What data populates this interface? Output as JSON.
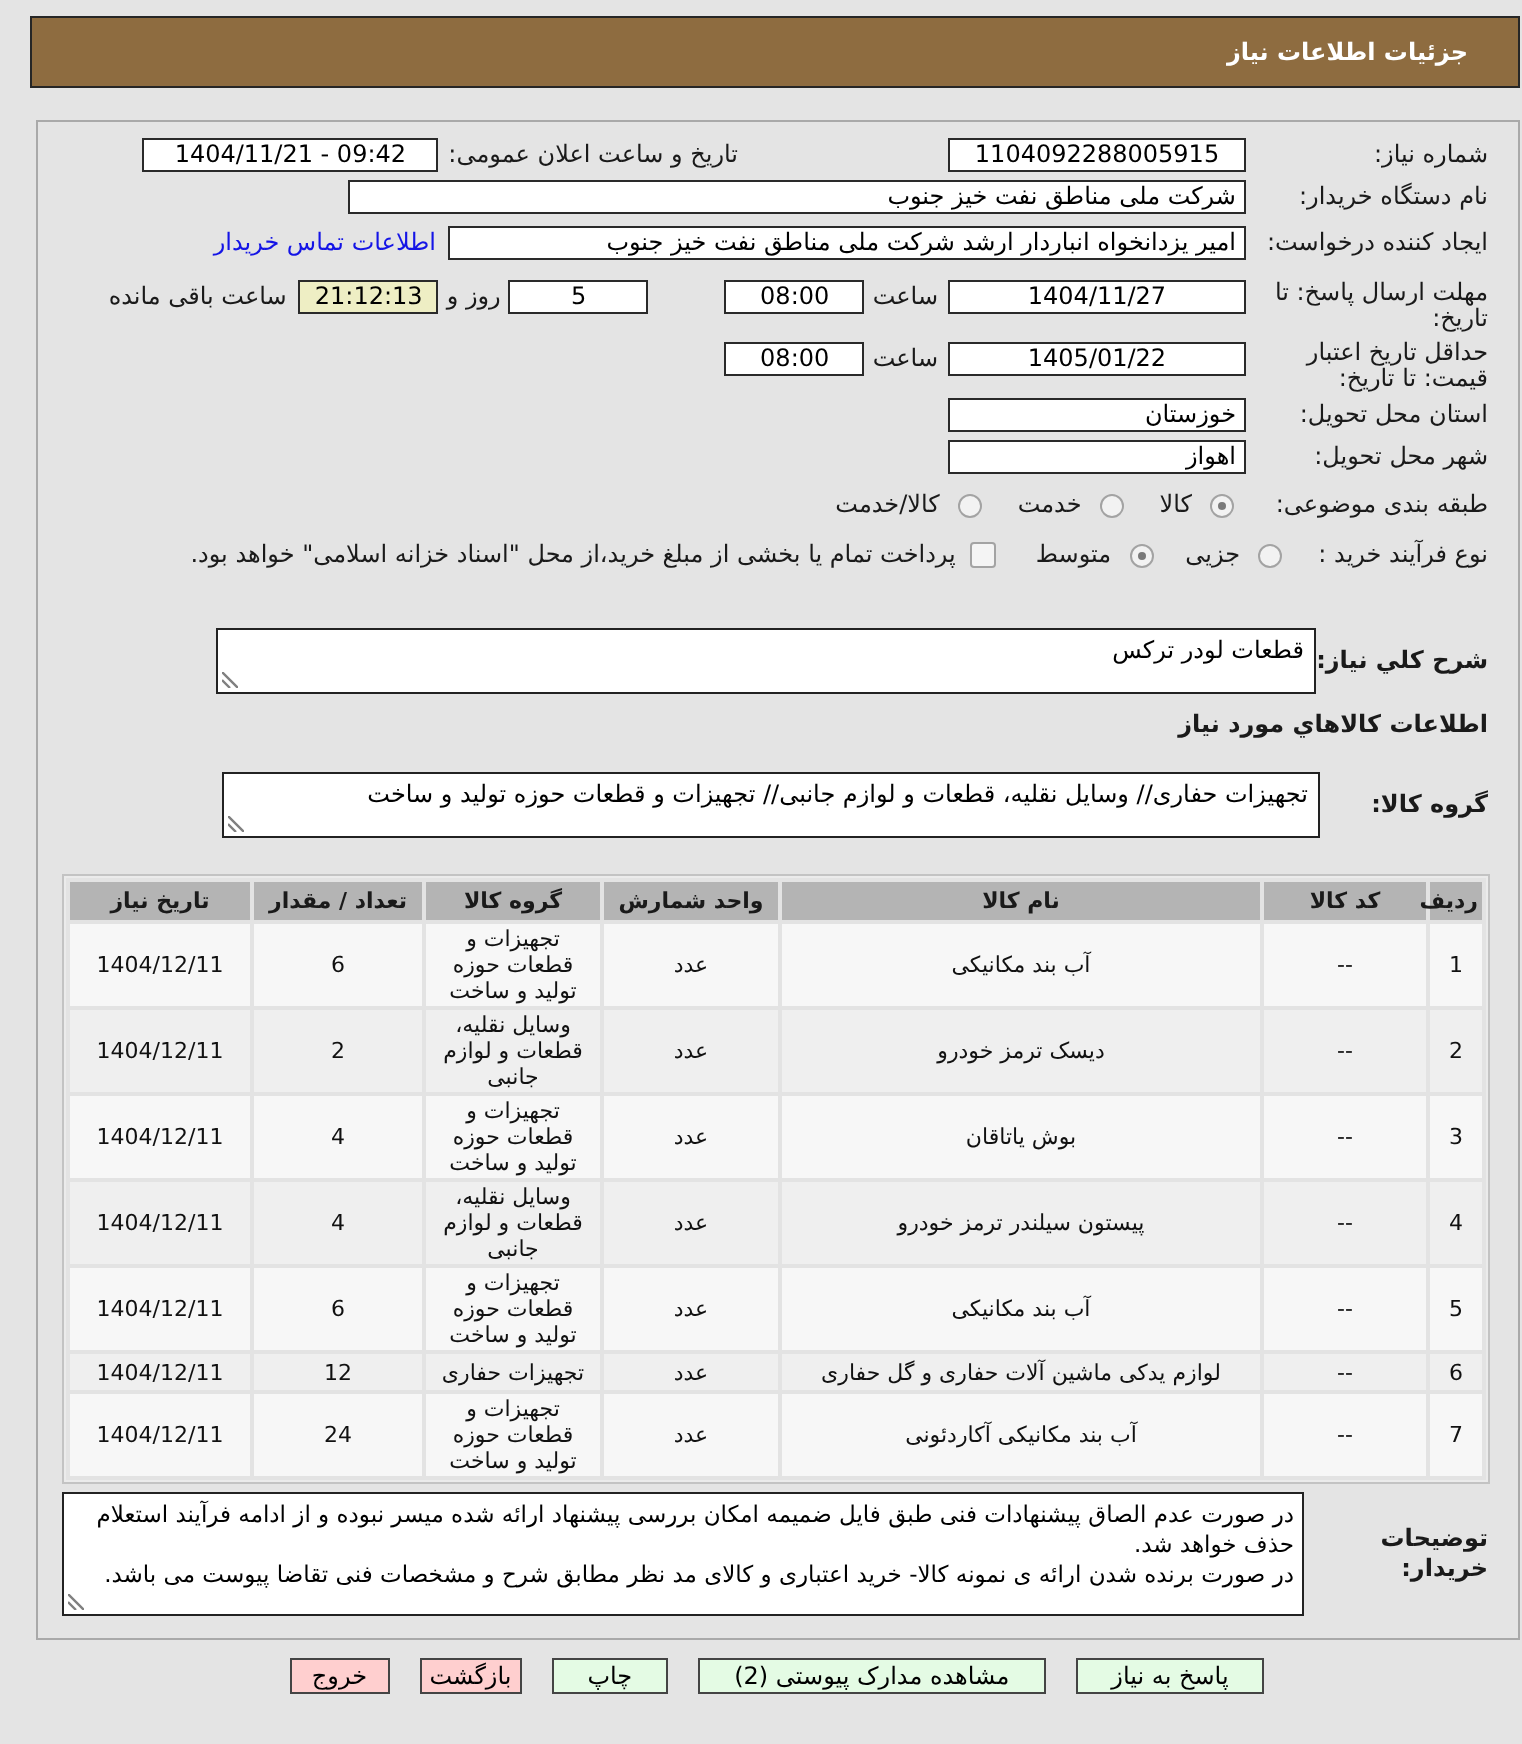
{
  "header": {
    "title": "جزئیات اطلاعات نیاز"
  },
  "form": {
    "need_number": {
      "label": "شماره نیاز:",
      "value": "1104092288005915"
    },
    "announcement": {
      "label": "تاریخ و ساعت اعلان عمومی:",
      "value": "1404/11/21 - 09:42"
    },
    "buyer_org": {
      "label": "نام دستگاه خریدار:",
      "value": "شرکت ملی مناطق نفت خیز جنوب"
    },
    "requester": {
      "label": "ایجاد کننده درخواست:",
      "value": "امیر یزدانخواه انباردار ارشد شرکت ملی مناطق نفت خیز جنوب",
      "contact_link": "اطلاعات تماس خریدار"
    },
    "reply_deadline": {
      "label": "مهلت ارسال پاسخ: تا تاریخ:",
      "date": "1404/11/27",
      "time_label": "ساعت",
      "time": "08:00",
      "days": "5",
      "days_label": "روز و",
      "remaining": "21:12:13",
      "remaining_label": "ساعت باقی مانده"
    },
    "price_validity": {
      "label": "حداقل تاریخ اعتبار قیمت: تا تاریخ:",
      "date": "1405/01/22",
      "time_label": "ساعت",
      "time": "08:00"
    },
    "province": {
      "label": "استان محل تحویل:",
      "value": "خوزستان"
    },
    "city": {
      "label": "شهر محل تحویل:",
      "value": "اهواز"
    },
    "category": {
      "label": "طبقه بندی موضوعی:",
      "options": [
        {
          "label": "کالا",
          "selected": true
        },
        {
          "label": "خدمت",
          "selected": false
        },
        {
          "label": "کالا/خدمت",
          "selected": false
        }
      ]
    },
    "purchase_process": {
      "label": "نوع فرآیند خرید :",
      "options": [
        {
          "label": "جزیی",
          "selected": false
        },
        {
          "label": "متوسط",
          "selected": true
        }
      ],
      "treasury_payment": {
        "label": "پرداخت تمام یا بخشی از مبلغ خرید،از محل \"اسناد خزانه اسلامی\" خواهد بود.",
        "checked": false
      }
    },
    "summary": {
      "label": "شرح کلي نياز:",
      "value": "قطعات لودر ترکس"
    },
    "goods_heading": "اطلاعات کالاهاي مورد نياز",
    "goods_group": {
      "label": "گروه کالا:",
      "value": "تجهیزات حفاری// وسایل نقلیه، قطعات و لوازم جانبی// تجهیزات و قطعات حوزه تولید و ساخت"
    },
    "goods_table": {
      "columns": [
        "ردیف",
        "کد کالا",
        "نام کالا",
        "واحد شمارش",
        "گروه کالا",
        "تعداد / مقدار",
        "تاریخ نیاز"
      ],
      "rows": [
        [
          "1",
          "--",
          "آب بند مکانیکی",
          "عدد",
          "تجهیزات و قطعات حوزه تولید و ساخت",
          "6",
          "1404/12/11"
        ],
        [
          "2",
          "--",
          "دیسک ترمز خودرو",
          "عدد",
          "وسایل نقلیه، قطعات و لوازم جانبی",
          "2",
          "1404/12/11"
        ],
        [
          "3",
          "--",
          "بوش یاتاقان",
          "عدد",
          "تجهیزات و قطعات حوزه تولید و ساخت",
          "4",
          "1404/12/11"
        ],
        [
          "4",
          "--",
          "پیستون سیلندر ترمز خودرو",
          "عدد",
          "وسایل نقلیه، قطعات و لوازم جانبی",
          "4",
          "1404/12/11"
        ],
        [
          "5",
          "--",
          "آب بند مکانیکی",
          "عدد",
          "تجهیزات و قطعات حوزه تولید و ساخت",
          "6",
          "1404/12/11"
        ],
        [
          "6",
          "--",
          "لوازم یدکی ماشین آلات حفاری و گل حفاری",
          "عدد",
          "تجهیزات حفاری",
          "12",
          "1404/12/11"
        ],
        [
          "7",
          "--",
          "آب بند مکانیکی آکاردئونی",
          "عدد",
          "تجهیزات و قطعات حوزه تولید و ساخت",
          "24",
          "1404/12/11"
        ]
      ]
    },
    "buyer_notes": {
      "label": "توضیحات خریدار:",
      "paragraphs": [
        "در صورت عدم الصاق پیشنهادات فنی طبق فایل ضمیمه امکان بررسی پیشنهاد ارائه شده میسر نبوده و از ادامه فرآیند استعلام حذف خواهد شد.",
        "در صورت برنده شدن ارائه ی نمونه کالا- خرید اعتباری و کالای مد نظر مطابق شرح و مشخصات فنی تقاضا پیوست می باشد."
      ]
    }
  },
  "buttons": [
    {
      "label": "پاسخ به نیاز",
      "kind": "normal"
    },
    {
      "label": "مشاهده مدارک پیوستی (2)",
      "kind": "normal"
    },
    {
      "label": "چاپ",
      "kind": "normal"
    },
    {
      "label": "بازگشت",
      "kind": "warning"
    },
    {
      "label": "خروج",
      "kind": "warning"
    }
  ]
}
